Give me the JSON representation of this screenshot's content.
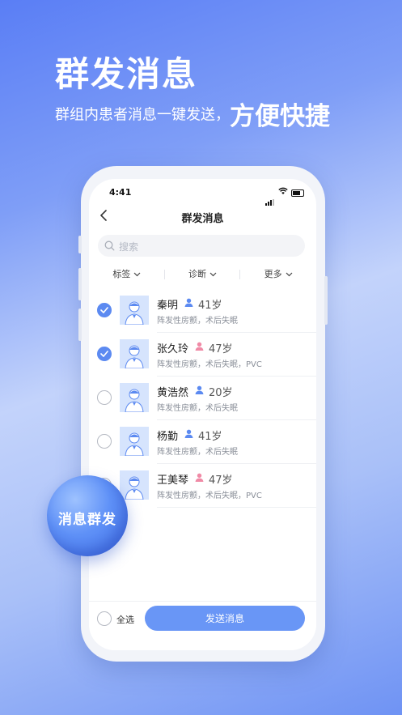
{
  "hero": {
    "title": "群发消息",
    "subtitle_small": "群组内患者消息一键发送，",
    "subtitle_big": "方便快捷"
  },
  "status_bar": {
    "time": "4:41"
  },
  "nav": {
    "title": "群发消息",
    "back_icon": "chevron-left-icon"
  },
  "search": {
    "placeholder": "搜索",
    "value": ""
  },
  "filters": [
    {
      "label": "标签",
      "icon": "chevron-down-icon"
    },
    {
      "label": "诊断",
      "icon": "chevron-down-icon"
    },
    {
      "label": "更多",
      "icon": "chevron-down-icon"
    }
  ],
  "patients": [
    {
      "name": "秦明",
      "gender": "male",
      "age": "41岁",
      "diagnosis": "阵发性房颤，术后失眠",
      "checked": true
    },
    {
      "name": "张久玲",
      "gender": "female",
      "age": "47岁",
      "diagnosis": "阵发性房颤，术后失眠，PVC",
      "checked": true
    },
    {
      "name": "黄浩然",
      "gender": "male",
      "age": "20岁",
      "diagnosis": "阵发性房颤，术后失眠",
      "checked": false
    },
    {
      "name": "杨勤",
      "gender": "male",
      "age": "41岁",
      "diagnosis": "阵发性房颤，术后失眠",
      "checked": false
    },
    {
      "name": "王美琴",
      "gender": "female",
      "age": "47岁",
      "diagnosis": "阵发性房颤，术后失眠，PVC",
      "checked": false
    }
  ],
  "bottom_bar": {
    "select_all_label": "全选",
    "send_label": "发送消息"
  },
  "badge": {
    "label": "消息群发"
  },
  "colors": {
    "accent": "#5c8af1",
    "male": "#5c8af1",
    "female": "#f08aa6"
  }
}
